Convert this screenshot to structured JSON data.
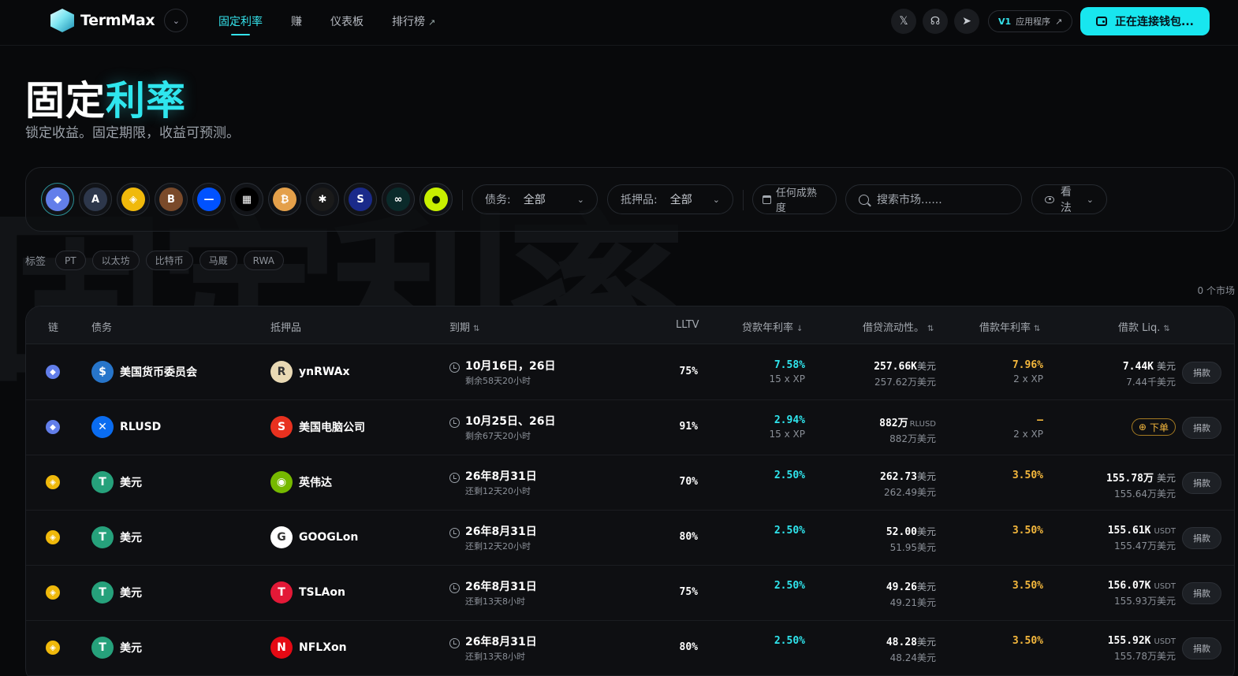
{
  "watermark": "固定利率",
  "brand": {
    "name": "TermMax"
  },
  "nav": [
    {
      "label": "固定利率",
      "active": true
    },
    {
      "label": "赚",
      "active": false
    },
    {
      "label": "仪表板",
      "active": false
    },
    {
      "label": "排行榜",
      "active": false,
      "external": true
    }
  ],
  "header": {
    "version_tag": "V1",
    "app_label": "应用程序",
    "connect_label": "正在连接钱包...",
    "social_icons": [
      "x-icon",
      "discord-icon",
      "telegram-icon"
    ]
  },
  "hero": {
    "title_a": "固定",
    "title_b": "利率",
    "subtitle": "锁定收益。固定期限，收益可预测。"
  },
  "filters": {
    "chains": [
      {
        "name": "ethereum",
        "glyph": "◆",
        "color": "#627eea"
      },
      {
        "name": "arbitrum",
        "glyph": "A",
        "color": "#2d374b"
      },
      {
        "name": "bnb",
        "glyph": "◈",
        "color": "#f0b90b"
      },
      {
        "name": "berachain",
        "glyph": "B",
        "color": "#7a4a2a"
      },
      {
        "name": "base",
        "glyph": "—",
        "color": "#0052ff"
      },
      {
        "name": "okx",
        "glyph": "▦",
        "color": "#000000"
      },
      {
        "name": "bitlayer",
        "glyph": "₿",
        "color": "#e4a04a"
      },
      {
        "name": "flare",
        "glyph": "✱",
        "color": "#1a1a1a"
      },
      {
        "name": "sonic",
        "glyph": "S",
        "color": "#1a2a8a"
      },
      {
        "name": "hyperliquid",
        "glyph": "∞",
        "color": "#0a2a2a"
      },
      {
        "name": "plasma",
        "glyph": "●",
        "color": "#c8f000"
      }
    ],
    "debt_label": "债务:",
    "debt_value": "全部",
    "collateral_label": "抵押品:",
    "collateral_value": "全部",
    "maturity_label": "任何成熟度",
    "search_placeholder": "搜索市场......",
    "view_label": "看法"
  },
  "tags": {
    "label": "标签",
    "items": [
      "PT",
      "以太坊",
      "比特币",
      "马厩",
      "RWA"
    ]
  },
  "market_count": "0 个市场",
  "table": {
    "headers": {
      "chain": "链",
      "debt": "债务",
      "collateral": "抵押品",
      "maturity": "到期",
      "lltv": "LLTV",
      "lend_apr": "贷款年利率",
      "liquidity": "借贷流动性。",
      "borrow_apr": "借款年利率",
      "borrow_liq": "借款 Liq."
    },
    "borrow_label": "捐款",
    "order_label": "下单",
    "rows": [
      {
        "chain": "eth",
        "debt": {
          "name": "美国货币委员会",
          "icon": "usdc-icon",
          "glyph": "$",
          "color": "#2775ca"
        },
        "collateral": {
          "name": "ynRWAx",
          "icon": "ynrwax-icon",
          "glyph": "R",
          "color": "#e9d9b4"
        },
        "maturity": "10月16日，26日",
        "left": "剩余58天20小时",
        "lltv": "75%",
        "lend_apr": "7.58%",
        "lend_xp": "15 x XP",
        "liq_main": "257.66K",
        "liq_unit": "美元",
        "liq_sub": "257.62万美元",
        "borrow_apr": "7.96%",
        "borrow_xp": "2 x XP",
        "bliq_main": "7.44K",
        "bliq_unit": "美元",
        "bliq_sub": "7.44千美元",
        "order": false
      },
      {
        "chain": "eth",
        "debt": {
          "name": "RLUSD",
          "icon": "rlusd-icon",
          "glyph": "✕",
          "color": "#0a6cf0"
        },
        "collateral": {
          "name": "美国电脑公司",
          "icon": "usdc-alt-icon",
          "glyph": "S",
          "color": "#e8311f"
        },
        "maturity": "10月25日、26日",
        "left": "剩余67天20小时",
        "lltv": "91%",
        "lend_apr": "2.94%",
        "lend_xp": "15 x XP",
        "liq_main": "882万",
        "liq_unit": "RLUSD",
        "liq_sub": "882万美元",
        "borrow_apr": "–",
        "borrow_xp": "2 x XP",
        "bliq_main": "",
        "bliq_unit": "",
        "bliq_sub": "",
        "order": true
      },
      {
        "chain": "bnb",
        "debt": {
          "name": "美元",
          "icon": "usdt-icon",
          "glyph": "T",
          "color": "#26a17b"
        },
        "collateral": {
          "name": "英伟达",
          "icon": "nvidia-icon",
          "glyph": "◉",
          "color": "#76b900"
        },
        "maturity": "26年8月31日",
        "left": "还剩12天20小时",
        "lltv": "70%",
        "lend_apr": "2.50%",
        "lend_xp": "",
        "liq_main": "262.73",
        "liq_unit": "美元",
        "liq_sub": "262.49美元",
        "borrow_apr": "3.50%",
        "borrow_xp": "",
        "bliq_main": "155.78万",
        "bliq_unit": "美元",
        "bliq_sub": "155.64万美元",
        "order": false
      },
      {
        "chain": "bnb",
        "debt": {
          "name": "美元",
          "icon": "usdt-icon",
          "glyph": "T",
          "color": "#26a17b"
        },
        "collateral": {
          "name": "GOOGLon",
          "icon": "google-icon",
          "glyph": "G",
          "color": "#ffffff"
        },
        "maturity": "26年8月31日",
        "left": "还剩12天20小时",
        "lltv": "80%",
        "lend_apr": "2.50%",
        "lend_xp": "",
        "liq_main": "52.00",
        "liq_unit": "美元",
        "liq_sub": "51.95美元",
        "borrow_apr": "3.50%",
        "borrow_xp": "",
        "bliq_main": "155.61K",
        "bliq_unit": "USDT",
        "bliq_sub": "155.47万美元",
        "order": false
      },
      {
        "chain": "bnb",
        "debt": {
          "name": "美元",
          "icon": "usdt-icon",
          "glyph": "T",
          "color": "#26a17b"
        },
        "collateral": {
          "name": "TSLAon",
          "icon": "tesla-icon",
          "glyph": "T",
          "color": "#e31937"
        },
        "maturity": "26年8月31日",
        "left": "还剩13天8小时",
        "lltv": "75%",
        "lend_apr": "2.50%",
        "lend_xp": "",
        "liq_main": "49.26",
        "liq_unit": "美元",
        "liq_sub": "49.21美元",
        "borrow_apr": "3.50%",
        "borrow_xp": "",
        "bliq_main": "156.07K",
        "bliq_unit": "USDT",
        "bliq_sub": "155.93万美元",
        "order": false
      },
      {
        "chain": "bnb",
        "debt": {
          "name": "美元",
          "icon": "usdt-icon",
          "glyph": "T",
          "color": "#26a17b"
        },
        "collateral": {
          "name": "NFLXon",
          "icon": "netflix-icon",
          "glyph": "N",
          "color": "#e50914"
        },
        "maturity": "26年8月31日",
        "left": "还剩13天8小时",
        "lltv": "80%",
        "lend_apr": "2.50%",
        "lend_xp": "",
        "liq_main": "48.28",
        "liq_unit": "美元",
        "liq_sub": "48.24美元",
        "borrow_apr": "3.50%",
        "borrow_xp": "",
        "bliq_main": "155.92K",
        "bliq_unit": "USDT",
        "bliq_sub": "155.78万美元",
        "order": false
      }
    ]
  }
}
